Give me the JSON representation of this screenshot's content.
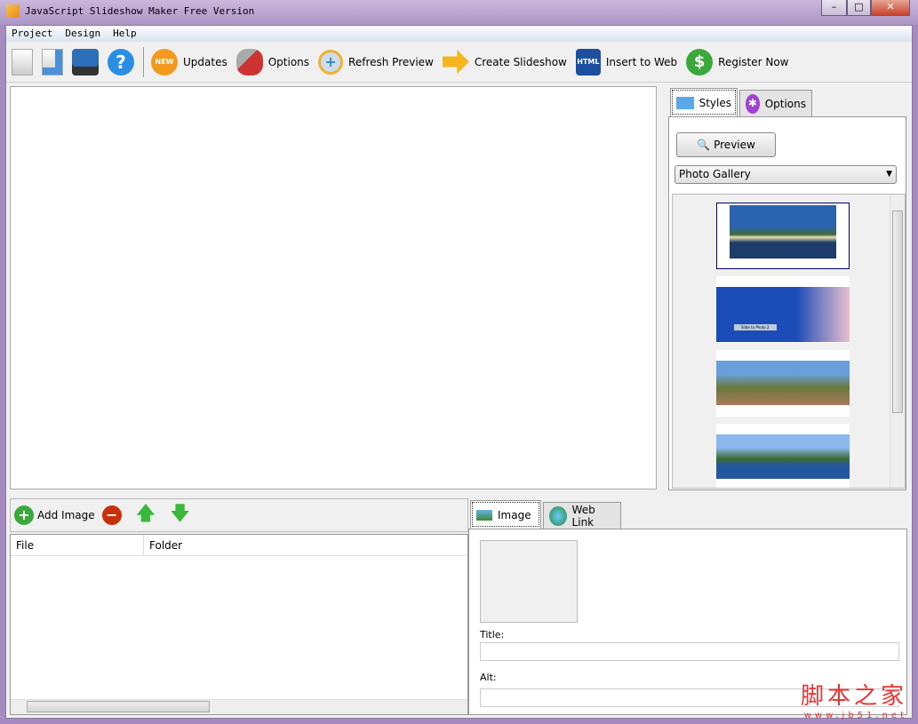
{
  "window": {
    "title": "JavaScript Slideshow Maker Free Version",
    "minimize": "–",
    "maximize": "□",
    "close": "✕"
  },
  "menu": [
    "Project",
    "Design",
    "Help"
  ],
  "toolbar": {
    "updates": "Updates",
    "new_badge": "NEW",
    "options": "Options",
    "refresh": "Refresh Preview",
    "create": "Create Slideshow",
    "insert": "Insert to Web",
    "html_badge": "HTML",
    "register": "Register Now"
  },
  "styles_panel": {
    "tab_styles": "Styles",
    "tab_options": "Options",
    "preview": "Preview",
    "style_select": "Photo Gallery",
    "thumb_caption": "Slide to Photo 2"
  },
  "images": {
    "add": "Add Image",
    "columns": [
      "File",
      "Folder"
    ]
  },
  "details": {
    "tab_image": "Image",
    "tab_weblink": "Web Link",
    "title_label": "Title:",
    "title_value": "",
    "alt_label": "Alt:",
    "alt_value": ""
  },
  "watermark": {
    "cn": "脚本之家",
    "url": "www.jb51.net"
  }
}
